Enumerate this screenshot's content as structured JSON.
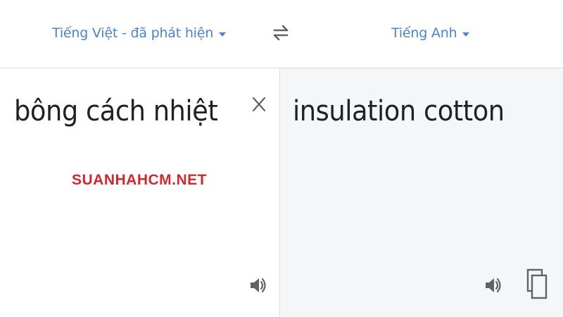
{
  "source_language": {
    "label": "Tiếng Việt - đã phát hiện",
    "dropdown_icon": "caret-down-icon"
  },
  "target_language": {
    "label": "Tiếng Anh",
    "dropdown_icon": "caret-down-icon"
  },
  "swap_icon": "swap-languages-icon",
  "source": {
    "text": "bông cách nhiệt",
    "clear_icon": "close-icon",
    "listen_icon": "speaker-icon"
  },
  "translation": {
    "text": "insulation cotton",
    "listen_icon": "speaker-icon",
    "copy_icon": "copy-icon"
  },
  "watermark": "SUANHAHCM.NET",
  "colors": {
    "accent": "#4a83d6",
    "text": "#202124",
    "icon": "#5f6368",
    "target_bg": "#f5f6f8",
    "watermark": "#d0282c"
  }
}
